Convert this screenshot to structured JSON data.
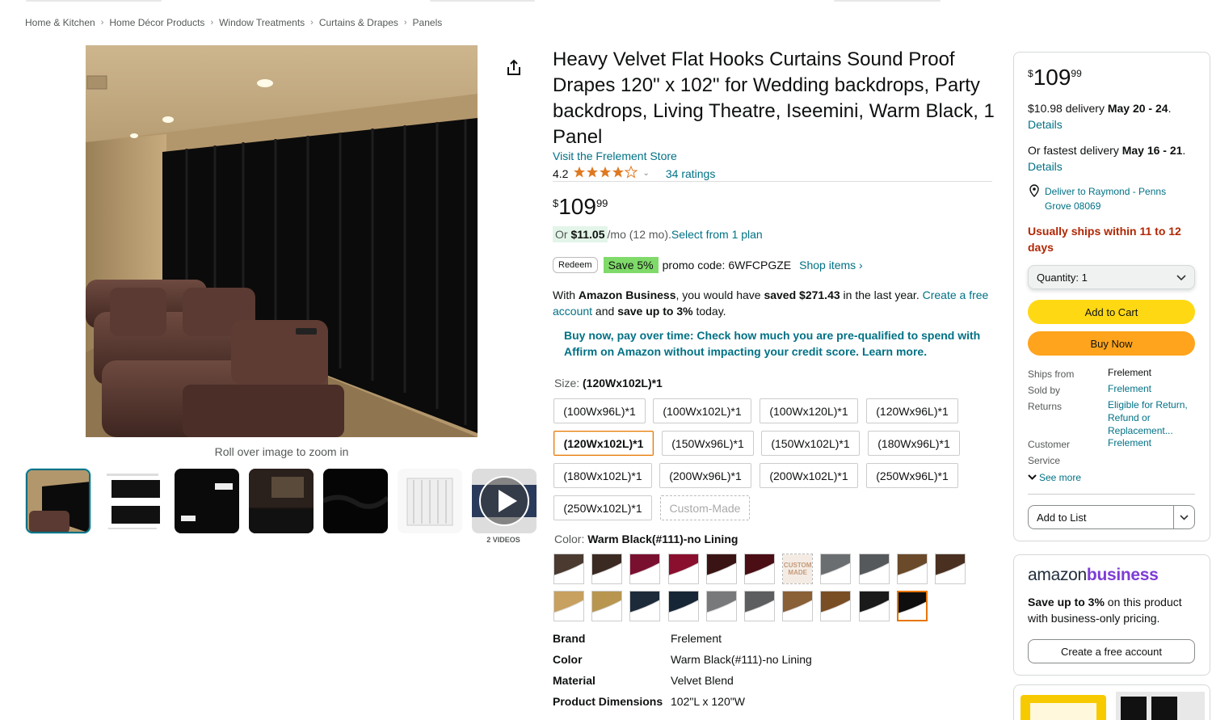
{
  "breadcrumb": [
    "Home & Kitchen",
    "Home Décor Products",
    "Window Treatments",
    "Curtains & Drapes",
    "Panels"
  ],
  "breadcrumb_sep": "›",
  "gallery": {
    "zoom_hint": "Roll over image to zoom in",
    "videos_label": "2 VIDEOS"
  },
  "product": {
    "title": "Heavy Velvet Flat Hooks Curtains Sound Proof Drapes 120\" x 102\" for Wedding backdrops, Party backdrops, Living Theatre, Iseemini, Warm Black, 1 Panel",
    "store_link": "Visit the Frelement Store",
    "rating": "4.2",
    "rating_stars": 4.2,
    "ratings_count": "34 ratings",
    "price_symbol": "$",
    "price_whole": "109",
    "price_fraction": "99",
    "monthly_or": "Or ",
    "monthly_amount": "$11.05",
    "monthly_suffix": " /mo (12 mo). ",
    "monthly_link": "Select from 1 plan",
    "redeem_label": "Redeem",
    "save_badge": "Save 5%",
    "promo_text": "promo code: 6WFCPGZE",
    "shop_items": "Shop items ›",
    "business_text": {
      "p1": "With ",
      "brand": "Amazon Business",
      "p2": ", you would have ",
      "saved": "saved $271.43",
      "p3": " in the last year. ",
      "link": "Create a free account",
      "p4": " and ",
      "save_up": "save up to 3%",
      "p5": " today."
    },
    "affirm_text": "Buy now, pay over time: Check how much you are pre-qualified to spend with Affirm on Amazon without impacting your credit score. Learn more.",
    "size_label": "Size: ",
    "size_selected": "(120Wx102L)*1",
    "sizes": [
      "(100Wx96L)*1",
      "(100Wx102L)*1",
      "(100Wx120L)*1",
      "(120Wx96L)*1",
      "(120Wx102L)*1",
      "(150Wx96L)*1",
      "(150Wx102L)*1",
      "(180Wx96L)*1",
      "(180Wx102L)*1",
      "(200Wx96L)*1",
      "(200Wx102L)*1",
      "(250Wx96L)*1",
      "(250Wx102L)*1",
      "Custom-Made"
    ],
    "color_label": "Color: ",
    "color_selected": "Warm Black(#111)-no Lining",
    "swatch_custom_text": "CUSTOM MADE",
    "swatch_colors": [
      "#4a3a30",
      "#3b2a22",
      "#7a1030",
      "#8a0f2e",
      "#3a1414",
      "#4a0e14",
      "custom",
      "#6b6e70",
      "#55595c",
      "#6a4a2a",
      "#4a3020",
      "#c8a060",
      "#b89650",
      "#1c2a3a",
      "#162636",
      "#78797a",
      "#5c5e60",
      "#8a6036",
      "#7a4e24",
      "#1a1a1a",
      "#0e0e0e"
    ],
    "specs": [
      {
        "k": "Brand",
        "v": "Frelement"
      },
      {
        "k": "Color",
        "v": "Warm Black(#111)-no Lining"
      },
      {
        "k": "Material",
        "v": "Velvet Blend"
      },
      {
        "k": "Product Dimensions",
        "v": "102\"L x 120\"W"
      }
    ]
  },
  "buybox": {
    "price_symbol": "$",
    "price_whole": "109",
    "price_fraction": "99",
    "delivery_pre": "$10.98 delivery ",
    "delivery_date": "May 20 - 24",
    "details": "Details",
    "fast_pre": "Or fastest delivery ",
    "fast_date": "May 16 - 21",
    "location": "Deliver to Raymond - Penns Grove 08069",
    "ships_warn": "Usually ships within 11 to 12 days",
    "quantity_label": "Quantity:",
    "quantity_value": "1",
    "add_to_cart": "Add to Cart",
    "buy_now": "Buy Now",
    "ships_from_k": "Ships from",
    "ships_from_v": "Frelement",
    "sold_by_k": "Sold by",
    "sold_by_v": "Frelement",
    "returns_k": "Returns",
    "returns_v": "Eligible for Return, Refund or Replacement...",
    "customer_k": "Customer",
    "service_k": "Service",
    "customer_v": "Frelement",
    "see_more": "See more",
    "add_to_list": "Add to List"
  },
  "business_box": {
    "logo_amazon": "amazon",
    "logo_business": "business",
    "save_bold": "Save up to 3%",
    "desc": " on this product with business-only pricing.",
    "button": "Create a free account"
  },
  "colors": {
    "accent_link": "#007185",
    "cart_yellow": "#ffd814",
    "buy_orange": "#ffa41c",
    "warn_red": "#b12704",
    "select_orange": "#e77600"
  }
}
